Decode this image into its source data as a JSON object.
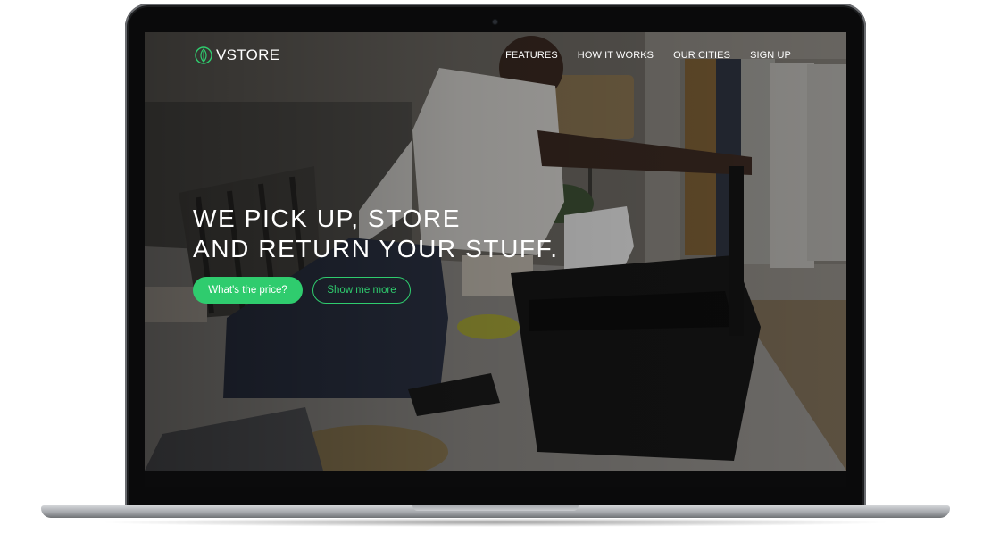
{
  "brand": {
    "name": "VSTORE",
    "accent_color": "#2fcc6e",
    "logo_icon": "leaf-emblem-icon"
  },
  "nav": {
    "items": [
      {
        "label": "FEATURES"
      },
      {
        "label": "HOW IT WORKS"
      },
      {
        "label": "OUR CITIES"
      },
      {
        "label": "SIGN UP"
      }
    ]
  },
  "hero": {
    "title_line1": "WE PICK UP, STORE",
    "title_line2": "AND RETURN YOUR STUFF.",
    "primary_button": "What's the price?",
    "secondary_button": "Show me more"
  }
}
